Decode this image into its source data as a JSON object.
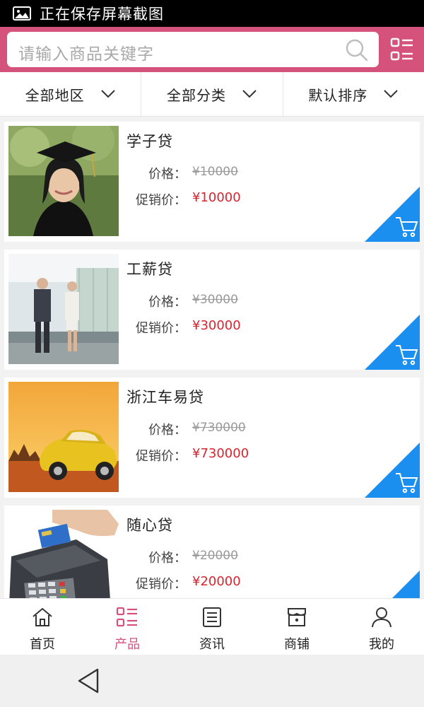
{
  "status_bar": {
    "text": "正在保存屏幕截图"
  },
  "search": {
    "placeholder": "请输入商品关键字"
  },
  "colors": {
    "brand": "#d5527d",
    "price_sale": "#d8252f",
    "cart_corner": "#1a8ff0"
  },
  "filters": [
    {
      "label": "全部地区"
    },
    {
      "label": "全部分类"
    },
    {
      "label": "默认排序"
    }
  ],
  "products": [
    {
      "title": "学子贷",
      "price_label": "价格：",
      "price": "¥10000",
      "sale_label": "促销价：",
      "sale_price": "¥10000",
      "image": "graduate-photo"
    },
    {
      "title": "工薪贷",
      "price_label": "价格：",
      "price": "¥30000",
      "sale_label": "促销价：",
      "sale_price": "¥30000",
      "image": "business-people-photo"
    },
    {
      "title": "浙江车易贷",
      "price_label": "价格：",
      "price": "¥730000",
      "sale_label": "促销价：",
      "sale_price": "¥730000",
      "image": "yellow-car-photo"
    },
    {
      "title": "随心贷",
      "price_label": "价格：",
      "price": "¥20000",
      "sale_label": "促销价：",
      "sale_price": "¥20000",
      "image": "card-terminal-photo"
    }
  ],
  "nav": [
    {
      "label": "首页",
      "icon": "home-icon"
    },
    {
      "label": "产品",
      "icon": "list-icon",
      "active": true
    },
    {
      "label": "资讯",
      "icon": "news-icon"
    },
    {
      "label": "商铺",
      "icon": "shop-icon"
    },
    {
      "label": "我的",
      "icon": "user-icon"
    }
  ]
}
